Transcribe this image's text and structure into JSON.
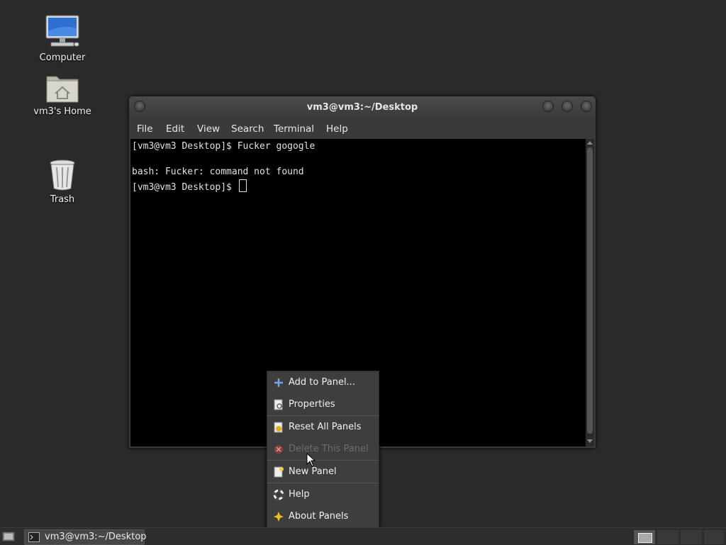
{
  "desktop": {
    "icons": [
      {
        "label": "Computer",
        "icon": "computer-icon"
      },
      {
        "label": "vm3's Home",
        "icon": "home-folder-icon"
      },
      {
        "label": "Trash",
        "icon": "trash-icon"
      }
    ]
  },
  "terminal": {
    "title": "vm3@vm3:~/Desktop",
    "menu": [
      "File",
      "Edit",
      "View",
      "Search",
      "Terminal",
      "Help"
    ],
    "lines": [
      "[vm3@vm3 Desktop]$ Fucker gogogle",
      "",
      "bash: Fucker: command not found",
      "[vm3@vm3 Desktop]$ "
    ]
  },
  "context_menu": {
    "items": [
      {
        "label": "Add to Panel...",
        "icon": "add-icon",
        "enabled": true
      },
      {
        "label": "Properties",
        "icon": "properties-icon",
        "enabled": true
      },
      {
        "label": "Reset All Panels",
        "icon": "reset-icon",
        "enabled": true
      },
      {
        "label": "Delete This Panel",
        "icon": "delete-icon",
        "enabled": false
      },
      {
        "label": "New Panel",
        "icon": "new-panel-icon",
        "enabled": true
      },
      {
        "label": "Help",
        "icon": "help-icon",
        "enabled": true
      },
      {
        "label": "About Panels",
        "icon": "about-icon",
        "enabled": true
      }
    ]
  },
  "taskbar": {
    "task_label": "vm3@vm3:~/Desktop"
  },
  "colors": {
    "desktop_bg": "#2a2a2a",
    "terminal_bg": "#000000",
    "menu_bg": "#3e3e3e"
  }
}
